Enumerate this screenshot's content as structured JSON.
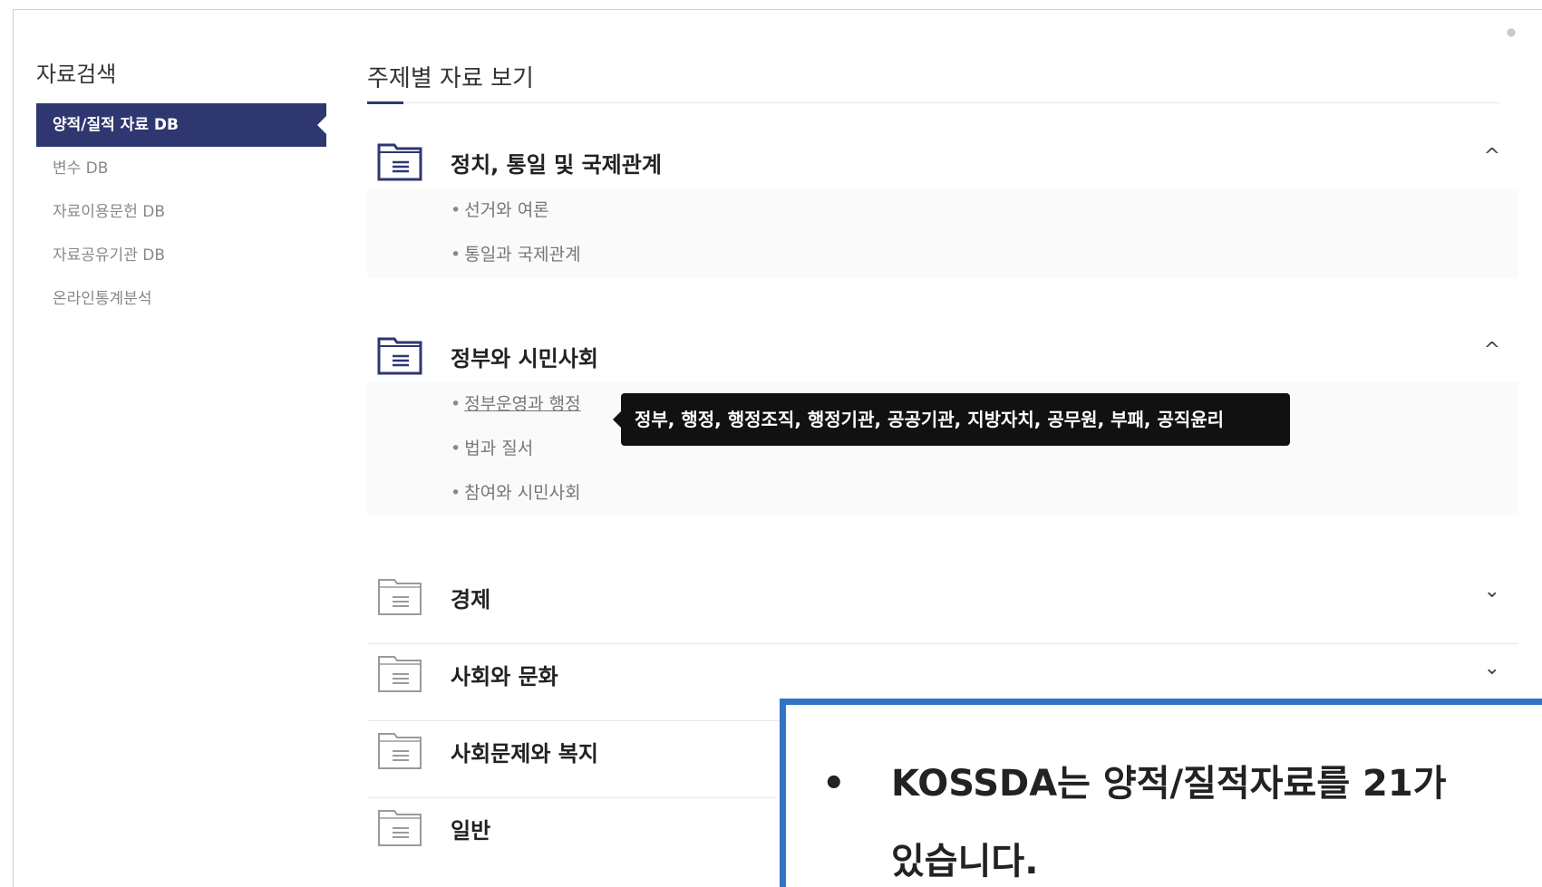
{
  "sidebar": {
    "title": "자료검색",
    "items": [
      {
        "label": "양적/질적 자료 DB",
        "active": true
      },
      {
        "label": "변수 DB",
        "active": false
      },
      {
        "label": "자료이용문헌 DB",
        "active": false
      },
      {
        "label": "자료공유기관 DB",
        "active": false
      },
      {
        "label": "온라인통계분석",
        "active": false
      }
    ]
  },
  "main": {
    "title": "주제별 자료 보기",
    "categories": [
      {
        "label": "정치, 통일 및 국제관계",
        "expanded": true,
        "chevron": "^",
        "items": [
          "선거와 여론",
          "통일과 국제관계"
        ]
      },
      {
        "label": "정부와 시민사회",
        "expanded": true,
        "chevron": "^",
        "items": [
          "정부운영과 행정",
          "법과 질서",
          "참여와 시민사회"
        ]
      },
      {
        "label": "경제",
        "expanded": false,
        "chevron": "⌄"
      },
      {
        "label": "사회와 문화",
        "expanded": false,
        "chevron": "⌄"
      },
      {
        "label": "사회문제와 복지",
        "expanded": false
      },
      {
        "label": "일반",
        "expanded": false
      }
    ],
    "tooltip": "정부, 행정, 행정조직, 행정기관, 공공기관, 지방자치, 공무원, 부패, 공직윤리"
  },
  "callout": {
    "bullet": "•",
    "line1": "KOSSDA는  양적/질적자료를  21가",
    "line2": "있습니다."
  },
  "colors": {
    "sidebar_active": "#2e3770",
    "callout_border": "#2f75c5",
    "tooltip_bg": "#111111"
  },
  "icons": {
    "folder": "folder-list-icon",
    "chevron_up": "chevron-up-icon",
    "chevron_down": "chevron-down-icon"
  }
}
